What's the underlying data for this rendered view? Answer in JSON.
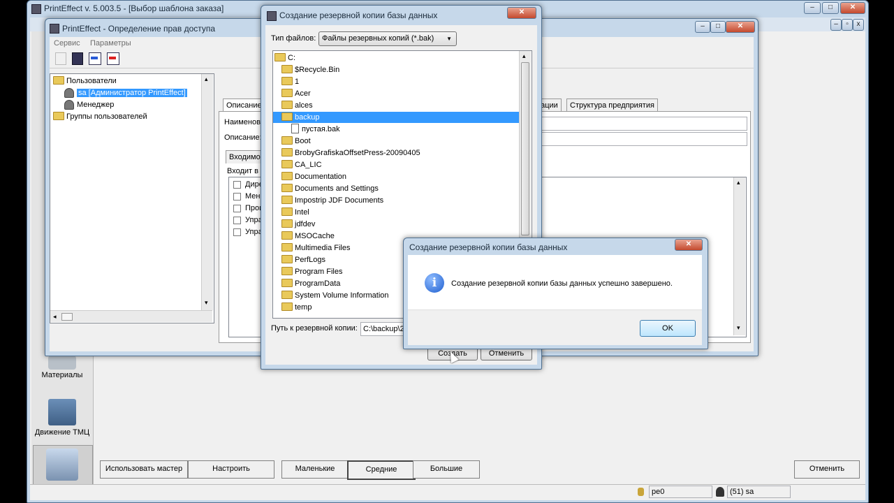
{
  "main_app": {
    "title": "PrintEffect v. 5.003.5 - [Выбор шаблона заказа]",
    "sidebar": [
      {
        "label": "Материалы",
        "icon": "materials-icon"
      },
      {
        "label": "Движение ТМЦ",
        "icon": "forklift-icon"
      },
      {
        "label": "",
        "icon": "order-manager-icon"
      }
    ],
    "bottom_buttons": {
      "wizard": "Использовать мастер",
      "configure": "Настроить",
      "small": "Маленькие",
      "medium": "Средние",
      "large": "Большие",
      "cancel": "Отменить"
    },
    "status": {
      "db": "pe0",
      "user": "(51) sa"
    }
  },
  "access_window": {
    "title": "PrintEffect - Определение прав доступа",
    "menu": [
      "Сервис",
      "Параметры"
    ],
    "tree": {
      "users_root": "Пользователи",
      "users": [
        "sa [Администратор PrintEffect]",
        "Менеджер"
      ],
      "groups_root": "Группы пользователей"
    },
    "tabs": {
      "description": "Описание",
      "partial": "рации",
      "structure": "Структура предприятия"
    },
    "labels": {
      "name": "Наименов",
      "description": "Описание:",
      "incoming": "Входимос",
      "member_of": "Входит в г"
    },
    "checklist": [
      "Дире",
      "Мене",
      "Прои",
      "Упра",
      "Упра"
    ]
  },
  "backup_dialog": {
    "title": "Создание резервной копии базы данных",
    "filetype_label": "Тип файлов:",
    "filetype_value": "Файлы резервных копий (*.bak)",
    "drive": "C:",
    "folders": [
      {
        "name": "$Recycle.Bin",
        "type": "folder"
      },
      {
        "name": "1",
        "type": "folder"
      },
      {
        "name": "Acer",
        "type": "folder"
      },
      {
        "name": "alces",
        "type": "folder"
      },
      {
        "name": "backup",
        "type": "folder-open"
      },
      {
        "name": "пустая.bak",
        "type": "file"
      },
      {
        "name": "Boot",
        "type": "folder"
      },
      {
        "name": "BrobyGrafiskaOffsetPress-20090405",
        "type": "folder"
      },
      {
        "name": "CA_LIC",
        "type": "folder"
      },
      {
        "name": "Documentation",
        "type": "folder"
      },
      {
        "name": "Documents and Settings",
        "type": "folder"
      },
      {
        "name": "Impostrip JDF Documents",
        "type": "folder"
      },
      {
        "name": "Intel",
        "type": "folder"
      },
      {
        "name": "jdfdev",
        "type": "folder"
      },
      {
        "name": "MSOCache",
        "type": "folder"
      },
      {
        "name": "Multimedia Files",
        "type": "folder"
      },
      {
        "name": "PerfLogs",
        "type": "folder"
      },
      {
        "name": "Program Files",
        "type": "folder"
      },
      {
        "name": "ProgramData",
        "type": "folder"
      },
      {
        "name": "System Volume Information",
        "type": "folder"
      },
      {
        "name": "temp",
        "type": "folder"
      }
    ],
    "path_label": "Путь к резервной копии:",
    "path_value": "C:\\backup\\2",
    "create_button": "Создать",
    "cancel_button": "Отменить"
  },
  "message_box": {
    "title": "Создание резервной копии базы данных",
    "message": "Создание резервной копии базы данных успешно завершено.",
    "ok": "OK",
    "icon": "info-icon"
  }
}
